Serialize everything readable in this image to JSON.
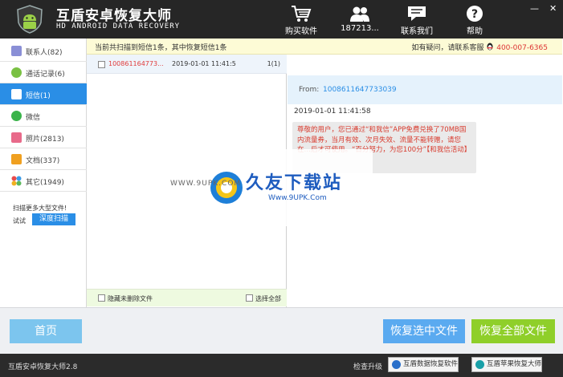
{
  "app": {
    "title": "互盾安卓恢复大师",
    "subtitle": "HD ANDROID DATA RECOVERY"
  },
  "toolbar": {
    "buy_label": "购买软件",
    "account_label": "187213...",
    "contact_label": "联系我们",
    "help_label": "帮助",
    "min_glyph": "—",
    "close_glyph": "✕"
  },
  "notice": {
    "left": "当前共扫描到短信1条，其中恢复短信1条",
    "right_prefix": "如有疑问，请联系客服",
    "phone": "400-007-6365"
  },
  "sidebar": {
    "items": [
      {
        "label": "联系人(82)",
        "icon": "contacts-icon",
        "color": "#8a8fd6"
      },
      {
        "label": "通话记录(6)",
        "icon": "phone-icon",
        "color": "#7ac143"
      },
      {
        "label": "短信(1)",
        "icon": "sms-icon",
        "color": "#ffffff"
      },
      {
        "label": "微信",
        "icon": "wechat-icon",
        "color": "#3ab34a"
      },
      {
        "label": "照片(2813)",
        "icon": "photo-icon",
        "color": "#e86a8a"
      },
      {
        "label": "文档(337)",
        "icon": "document-icon",
        "color": "#f0a020"
      },
      {
        "label": "其它(1949)",
        "icon": "other-icon",
        "color": "#e84b4b"
      }
    ],
    "deep_hint": "扫描更多大型文件!",
    "deep_try": "试试",
    "deep_button": "深度扫描"
  },
  "list": {
    "rows": [
      {
        "number": "100861164773...",
        "time": "2019-01-01 11:41:5",
        "count": "1(1)"
      }
    ],
    "hide_undeleted": "隐藏未删除文件",
    "select_all": "选择全部"
  },
  "detail": {
    "from_label": "From:",
    "from_value": "1008611647733039",
    "time": "2019-01-01 11:41:58",
    "message": "尊敬的用户，您已通过“和我信”APP免费兑换了70MB国内流量券，当月有效、次月失效、流量不能转赠，请您在…后才可使用。“百分努力，为您100分”【和我信活动】"
  },
  "watermark": {
    "text": "久友下载站",
    "url": "Www.9UPK.Com",
    "url2": "WWW.9UPK.COM"
  },
  "buttons": {
    "home": "首页",
    "recover_selected": "恢复选中文件",
    "recover_all": "恢复全部文件"
  },
  "status": {
    "version": "互盾安卓恢复大师2.8",
    "upgrade": "检查升级",
    "btn1": "互盾数据恢复软件",
    "btn2": "互盾苹果恢复大师"
  },
  "colors": {
    "accent_blue": "#2a8ee6",
    "recover_all_green": "#8fcf2a",
    "title_bar": "#262626"
  }
}
